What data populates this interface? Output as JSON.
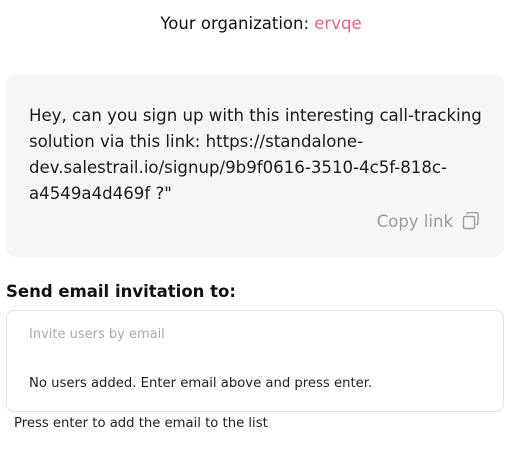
{
  "header": {
    "org_label": "Your organization: ",
    "org_name": "ervqe"
  },
  "share": {
    "message": "Hey, can you sign up with this interesting call-tracking solution via this link: https://standalone-dev.salestrail.io/signup/9b9f0616-3510-4c5f-818c-a4549a4d469f ?\"",
    "copy_label": "Copy link",
    "copy_icon": "copy-icon"
  },
  "invite": {
    "section_title": "Send email invitation to:",
    "placeholder": "Invite users by email",
    "value": "",
    "empty_message": "No users added. Enter email above and press enter.",
    "helper": "Press enter to add the email to the list"
  },
  "colors": {
    "accent": "#f0607a",
    "card_bg": "#f6f6f8",
    "muted": "#9a9aa3",
    "border": "#e2e2e6"
  }
}
